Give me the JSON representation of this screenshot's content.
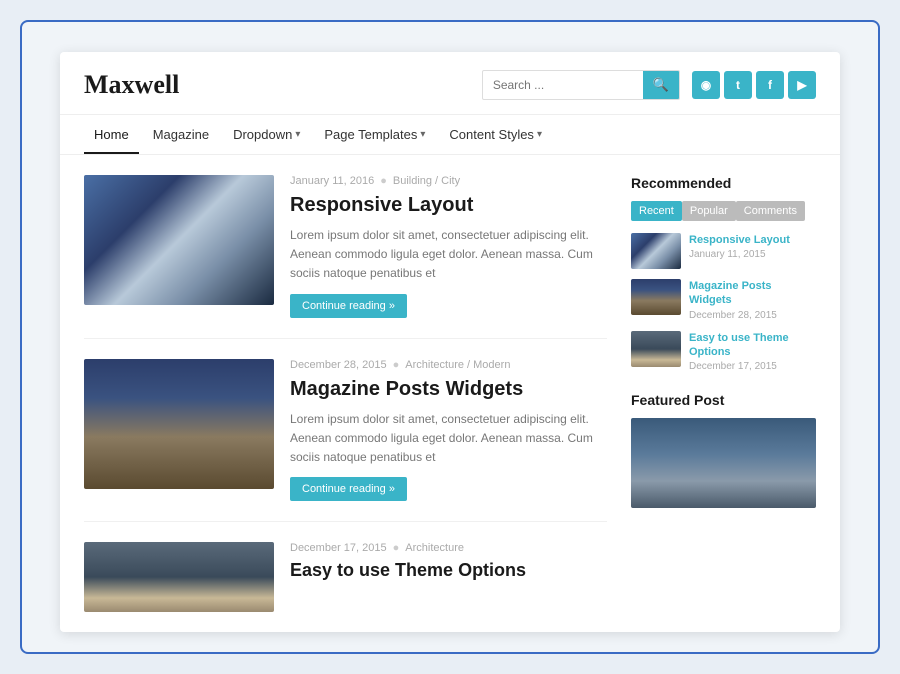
{
  "site": {
    "logo": "Maxwell",
    "search_placeholder": "Search ...",
    "search_btn": "🔍"
  },
  "social": [
    {
      "name": "rss",
      "label": "RSS",
      "symbol": "◉"
    },
    {
      "name": "twitter",
      "label": "Twitter",
      "symbol": "t"
    },
    {
      "name": "facebook",
      "label": "Facebook",
      "symbol": "f"
    },
    {
      "name": "youtube",
      "label": "YouTube",
      "symbol": "▶"
    }
  ],
  "nav": {
    "items": [
      {
        "label": "Home",
        "active": true,
        "has_dropdown": false
      },
      {
        "label": "Magazine",
        "active": false,
        "has_dropdown": false
      },
      {
        "label": "Dropdown",
        "active": false,
        "has_dropdown": true
      },
      {
        "label": "Page Templates",
        "active": false,
        "has_dropdown": true
      },
      {
        "label": "Content Styles",
        "active": false,
        "has_dropdown": true
      }
    ]
  },
  "posts": [
    {
      "date": "January 11, 2016",
      "category": "Building / City",
      "title": "Responsive Layout",
      "excerpt": "Lorem ipsum dolor sit amet, consectetuer adipiscing elit. Aenean commodo ligula eget dolor. Aenean massa. Cum sociis natoque penatibus et",
      "btn_label": "Continue reading »",
      "thumb_class": "thumb-building"
    },
    {
      "date": "December 28, 2015",
      "category": "Architecture / Modern",
      "title": "Magazine Posts Widgets",
      "excerpt": "Lorem ipsum dolor sit amet, consectetuer adipiscing elit. Aenean commodo ligula eget dolor. Aenean massa. Cum sociis natoque penatibus et",
      "btn_label": "Continue reading »",
      "thumb_class": "thumb-observatory"
    },
    {
      "date": "December 17, 2015",
      "category": "Architecture",
      "title": "Easy to use Theme Options",
      "excerpt": "",
      "btn_label": "",
      "thumb_class": "thumb-architecture"
    }
  ],
  "sidebar": {
    "recommended": {
      "title": "Recommended",
      "tabs": [
        "Recent",
        "Popular",
        "Comments"
      ],
      "active_tab": "Recent",
      "items": [
        {
          "title": "Responsive Layout",
          "date": "January 11, 2015",
          "thumb_class": "thumb-building"
        },
        {
          "title": "Magazine Posts Widgets",
          "date": "December 28, 2015",
          "thumb_class": "thumb-observatory"
        },
        {
          "title": "Easy to use Theme Options",
          "date": "December 17, 2015",
          "thumb_class": "thumb-architecture"
        }
      ]
    },
    "featured": {
      "title": "Featured Post"
    }
  }
}
